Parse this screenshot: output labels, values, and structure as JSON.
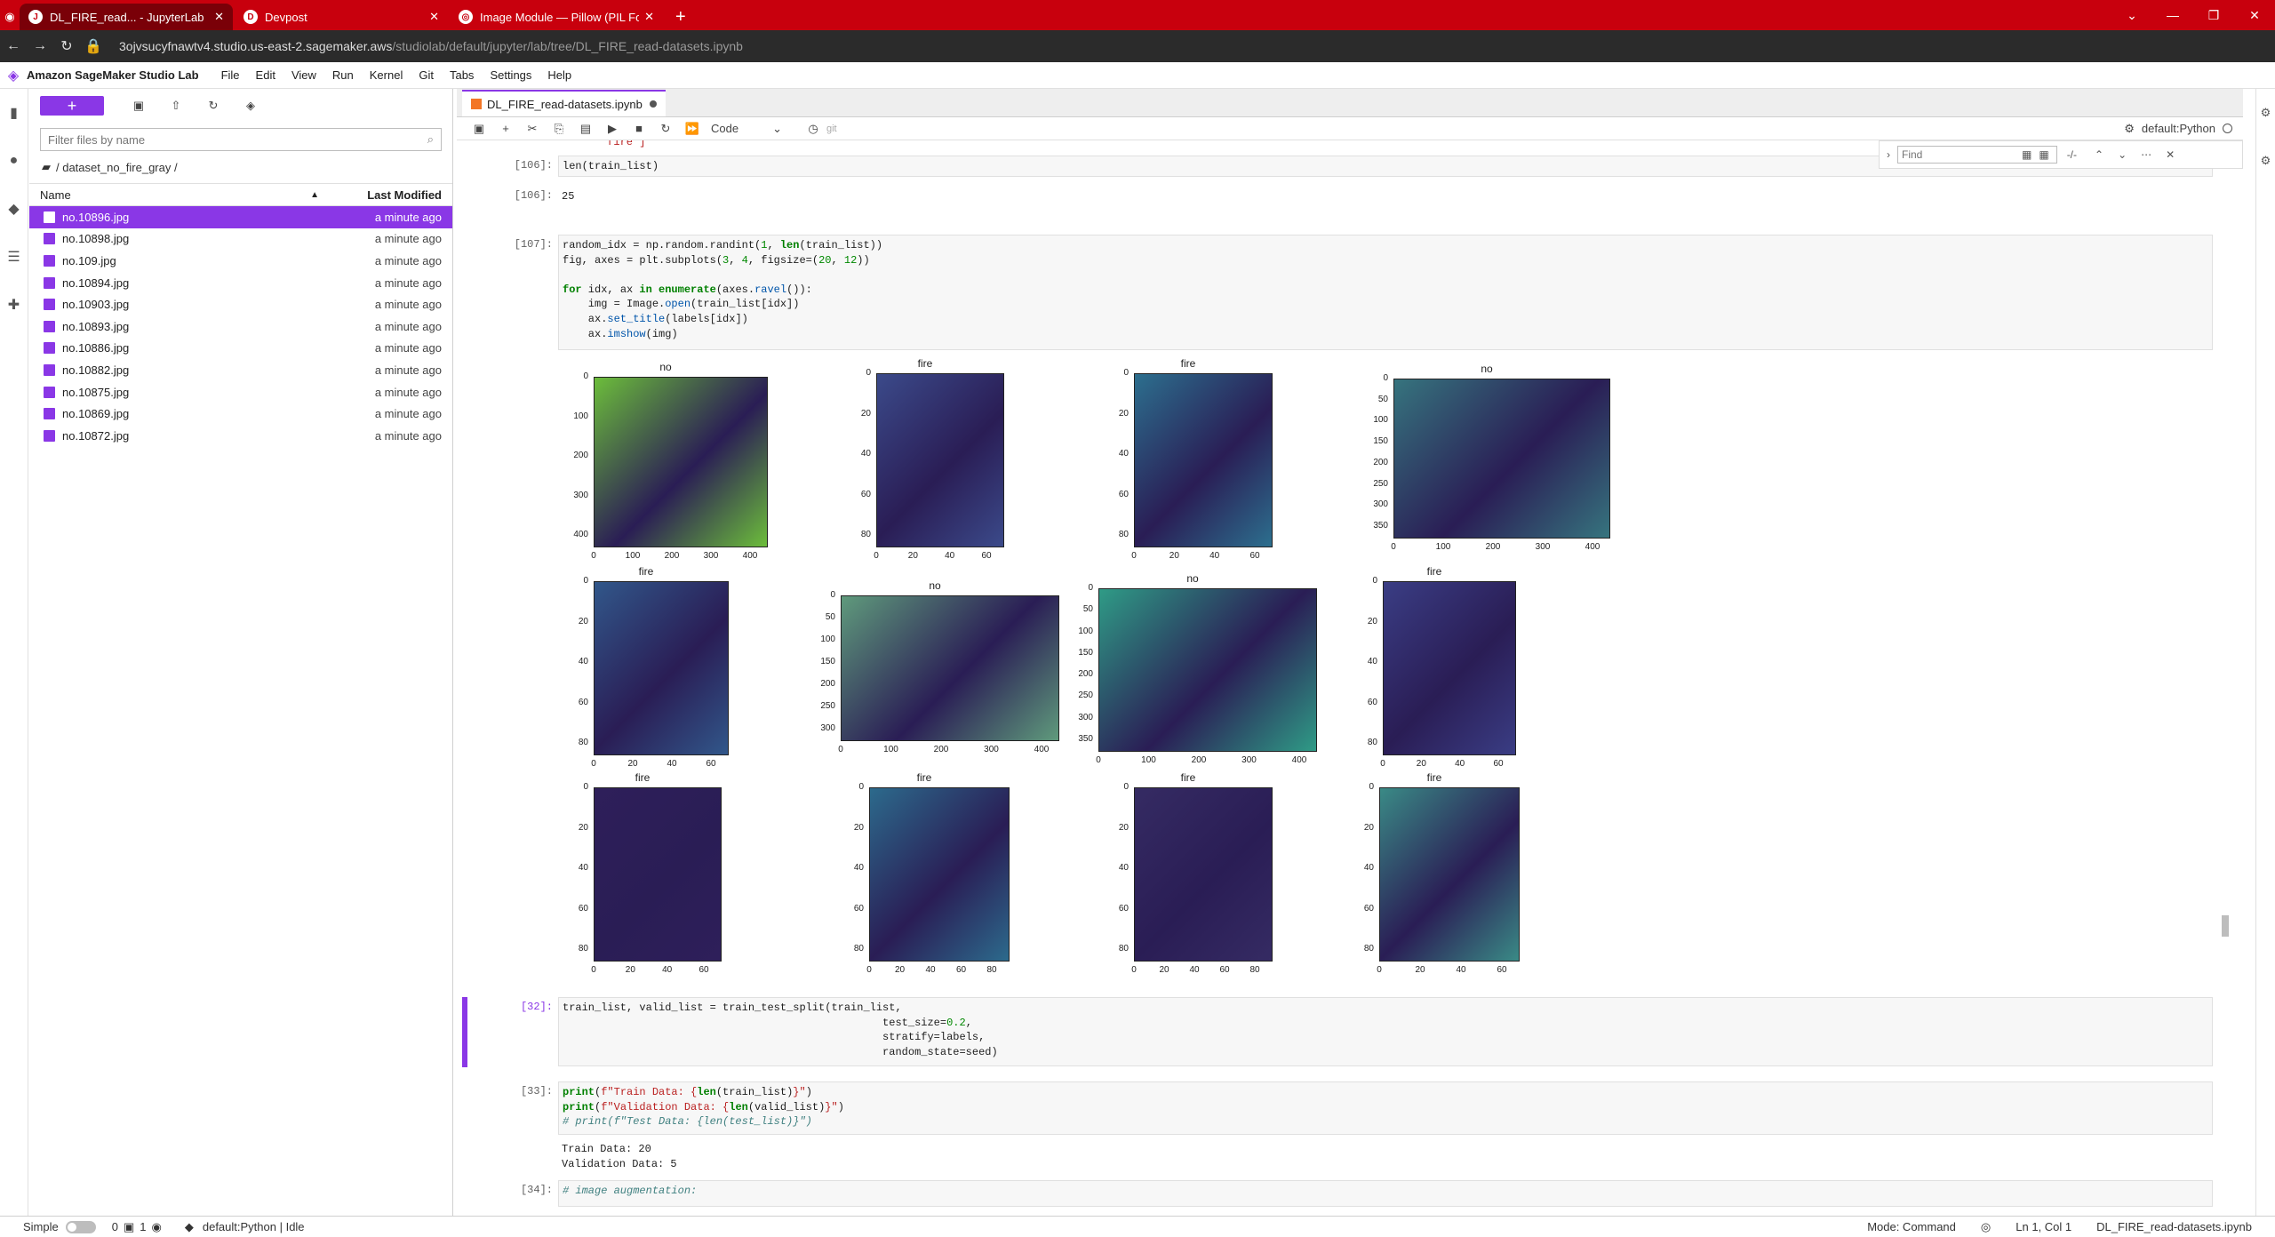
{
  "browser": {
    "tabs": [
      {
        "title": "DL_FIRE_read... - JupyterLab",
        "icon": "J"
      },
      {
        "title": "Devpost",
        "icon": "D"
      },
      {
        "title": "Image Module — Pillow (PIL Fork",
        "icon": "◎"
      }
    ],
    "url_host": "3ojvsucyfnawtv4.studio.us-east-2.sagemaker.aws",
    "url_path": "/studiolab/default/jupyter/lab/tree/DL_FIRE_read-datasets.ipynb"
  },
  "menubar": {
    "title": "Amazon SageMaker Studio Lab",
    "items": [
      "File",
      "Edit",
      "View",
      "Run",
      "Kernel",
      "Git",
      "Tabs",
      "Settings",
      "Help"
    ]
  },
  "filebrowser": {
    "new_label": "+",
    "filter_placeholder": "Filter files by name",
    "breadcrumb": "/ dataset_no_fire_gray /",
    "col_name": "Name",
    "col_modified": "Last Modified",
    "files": [
      {
        "name": "no.10896.jpg",
        "modified": "a minute ago"
      },
      {
        "name": "no.10898.jpg",
        "modified": "a minute ago"
      },
      {
        "name": "no.109.jpg",
        "modified": "a minute ago"
      },
      {
        "name": "no.10894.jpg",
        "modified": "a minute ago"
      },
      {
        "name": "no.10903.jpg",
        "modified": "a minute ago"
      },
      {
        "name": "no.10893.jpg",
        "modified": "a minute ago"
      },
      {
        "name": "no.10886.jpg",
        "modified": "a minute ago"
      },
      {
        "name": "no.10882.jpg",
        "modified": "a minute ago"
      },
      {
        "name": "no.10875.jpg",
        "modified": "a minute ago"
      },
      {
        "name": "no.10869.jpg",
        "modified": "a minute ago"
      },
      {
        "name": "no.10872.jpg",
        "modified": "a minute ago"
      }
    ]
  },
  "doc_tab": {
    "title": "DL_FIRE_read-datasets.ipynb"
  },
  "nb_toolbar": {
    "cell_type": "Code",
    "git": "git",
    "kernel": "default:Python"
  },
  "find": {
    "placeholder": "Find",
    "count": "-/-"
  },
  "cells": {
    "c0_out_tail": "'fire']",
    "c106_prompt": "[106]:",
    "c106_code": "len(train_list)",
    "c106_out_prompt": "[106]:",
    "c106_out": "25",
    "c107_prompt": "[107]:",
    "c32_prompt": "[32]:",
    "c33_prompt": "[33]:",
    "c33_out": "Train Data: 20\nValidation Data: 5",
    "c34_prompt": "[34]:"
  },
  "subplots": [
    {
      "title": "no",
      "yticks": [
        "0",
        "100",
        "200",
        "300",
        "400"
      ],
      "xticks": [
        "0",
        "100",
        "200",
        "300",
        "400"
      ],
      "color": "#6cbd3b"
    },
    {
      "title": "fire",
      "yticks": [
        "0",
        "20",
        "40",
        "60",
        "80"
      ],
      "xticks": [
        "0",
        "20",
        "40",
        "60"
      ],
      "color": "#3b4a8a"
    },
    {
      "title": "fire",
      "yticks": [
        "0",
        "20",
        "40",
        "60",
        "80"
      ],
      "xticks": [
        "0",
        "20",
        "40",
        "60"
      ],
      "color": "#2c6f8e"
    },
    {
      "title": "no",
      "yticks": [
        "0",
        "50",
        "100",
        "150",
        "200",
        "250",
        "300",
        "350"
      ],
      "xticks": [
        "0",
        "100",
        "200",
        "300",
        "400"
      ],
      "color": "#36747e"
    },
    {
      "title": "fire",
      "yticks": [
        "0",
        "20",
        "40",
        "60",
        "80"
      ],
      "xticks": [
        "0",
        "20",
        "40",
        "60"
      ],
      "color": "#31578a"
    },
    {
      "title": "no",
      "yticks": [
        "0",
        "50",
        "100",
        "150",
        "200",
        "250",
        "300"
      ],
      "xticks": [
        "0",
        "100",
        "200",
        "300",
        "400"
      ],
      "color": "#5f9a7c"
    },
    {
      "title": "no",
      "yticks": [
        "0",
        "50",
        "100",
        "150",
        "200",
        "250",
        "300",
        "350"
      ],
      "xticks": [
        "0",
        "100",
        "200",
        "300",
        "400"
      ],
      "color": "#2f9b86"
    },
    {
      "title": "fire",
      "yticks": [
        "0",
        "20",
        "40",
        "60",
        "80"
      ],
      "xticks": [
        "0",
        "20",
        "40",
        "60"
      ],
      "color": "#3a3d84"
    },
    {
      "title": "fire",
      "yticks": [
        "0",
        "20",
        "40",
        "60",
        "80"
      ],
      "xticks": [
        "0",
        "20",
        "40",
        "60"
      ],
      "color": "#2e1f5a"
    },
    {
      "title": "fire",
      "yticks": [
        "0",
        "20",
        "40",
        "60",
        "80"
      ],
      "xticks": [
        "0",
        "20",
        "40",
        "60",
        "80"
      ],
      "color": "#2c6a8c"
    },
    {
      "title": "fire",
      "yticks": [
        "0",
        "20",
        "40",
        "60",
        "80"
      ],
      "xticks": [
        "0",
        "20",
        "40",
        "60",
        "80"
      ],
      "color": "#352b63"
    },
    {
      "title": "fire",
      "yticks": [
        "0",
        "20",
        "40",
        "60",
        "80"
      ],
      "xticks": [
        "0",
        "20",
        "40",
        "60"
      ],
      "color": "#3a8a86"
    }
  ],
  "statusbar": {
    "mode_label": "Simple",
    "count0": "0",
    "count1": "1",
    "kernel": "default:Python | Idle",
    "mode": "Mode: Command",
    "position": "Ln 1, Col 1",
    "file": "DL_FIRE_read-datasets.ipynb"
  }
}
